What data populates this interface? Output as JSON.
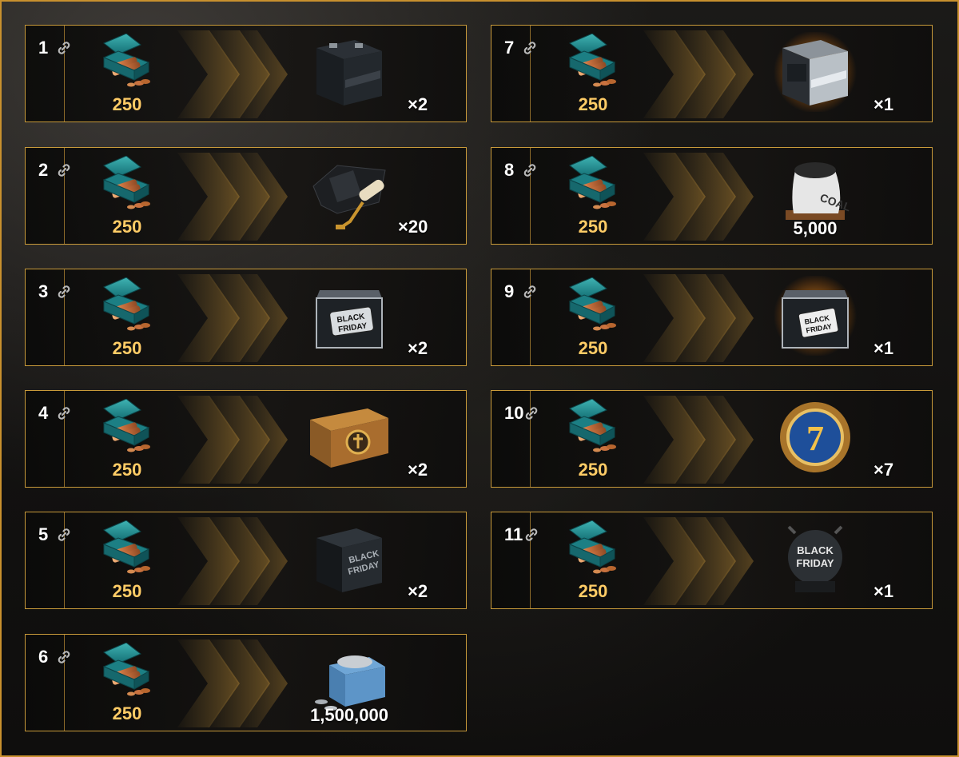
{
  "rewards": [
    {
      "step": "1",
      "cost": "250",
      "reward_icon": "black-container-icon",
      "quantity": "×2"
    },
    {
      "step": "2",
      "cost": "250",
      "reward_icon": "camouflage-roller-icon",
      "quantity": "×20"
    },
    {
      "step": "3",
      "cost": "250",
      "reward_icon": "black-friday-crate-icon",
      "quantity": "×2"
    },
    {
      "step": "4",
      "cost": "250",
      "reward_icon": "wooden-chest-icon",
      "quantity": "×2"
    },
    {
      "step": "5",
      "cost": "250",
      "reward_icon": "black-friday-box-icon",
      "quantity": "×2"
    },
    {
      "step": "6",
      "cost": "250",
      "reward_icon": "credits-chest-icon",
      "quantity": "1,500,000"
    },
    {
      "step": "7",
      "cost": "250",
      "reward_icon": "glowing-container-icon",
      "quantity": "×1"
    },
    {
      "step": "8",
      "cost": "250",
      "reward_icon": "coal-sack-icon",
      "quantity": "5,000"
    },
    {
      "step": "9",
      "cost": "250",
      "reward_icon": "black-friday-glowing-crate-icon",
      "quantity": "×1"
    },
    {
      "step": "10",
      "cost": "250",
      "reward_icon": "premium-days-7-icon",
      "quantity": "×7"
    },
    {
      "step": "11",
      "cost": "250",
      "reward_icon": "black-friday-mine-icon",
      "quantity": "×1"
    }
  ],
  "colors": {
    "border_gold": "#c89a3a",
    "cost_text": "#ffcc66",
    "crate_teal": "#1f8a8f"
  }
}
